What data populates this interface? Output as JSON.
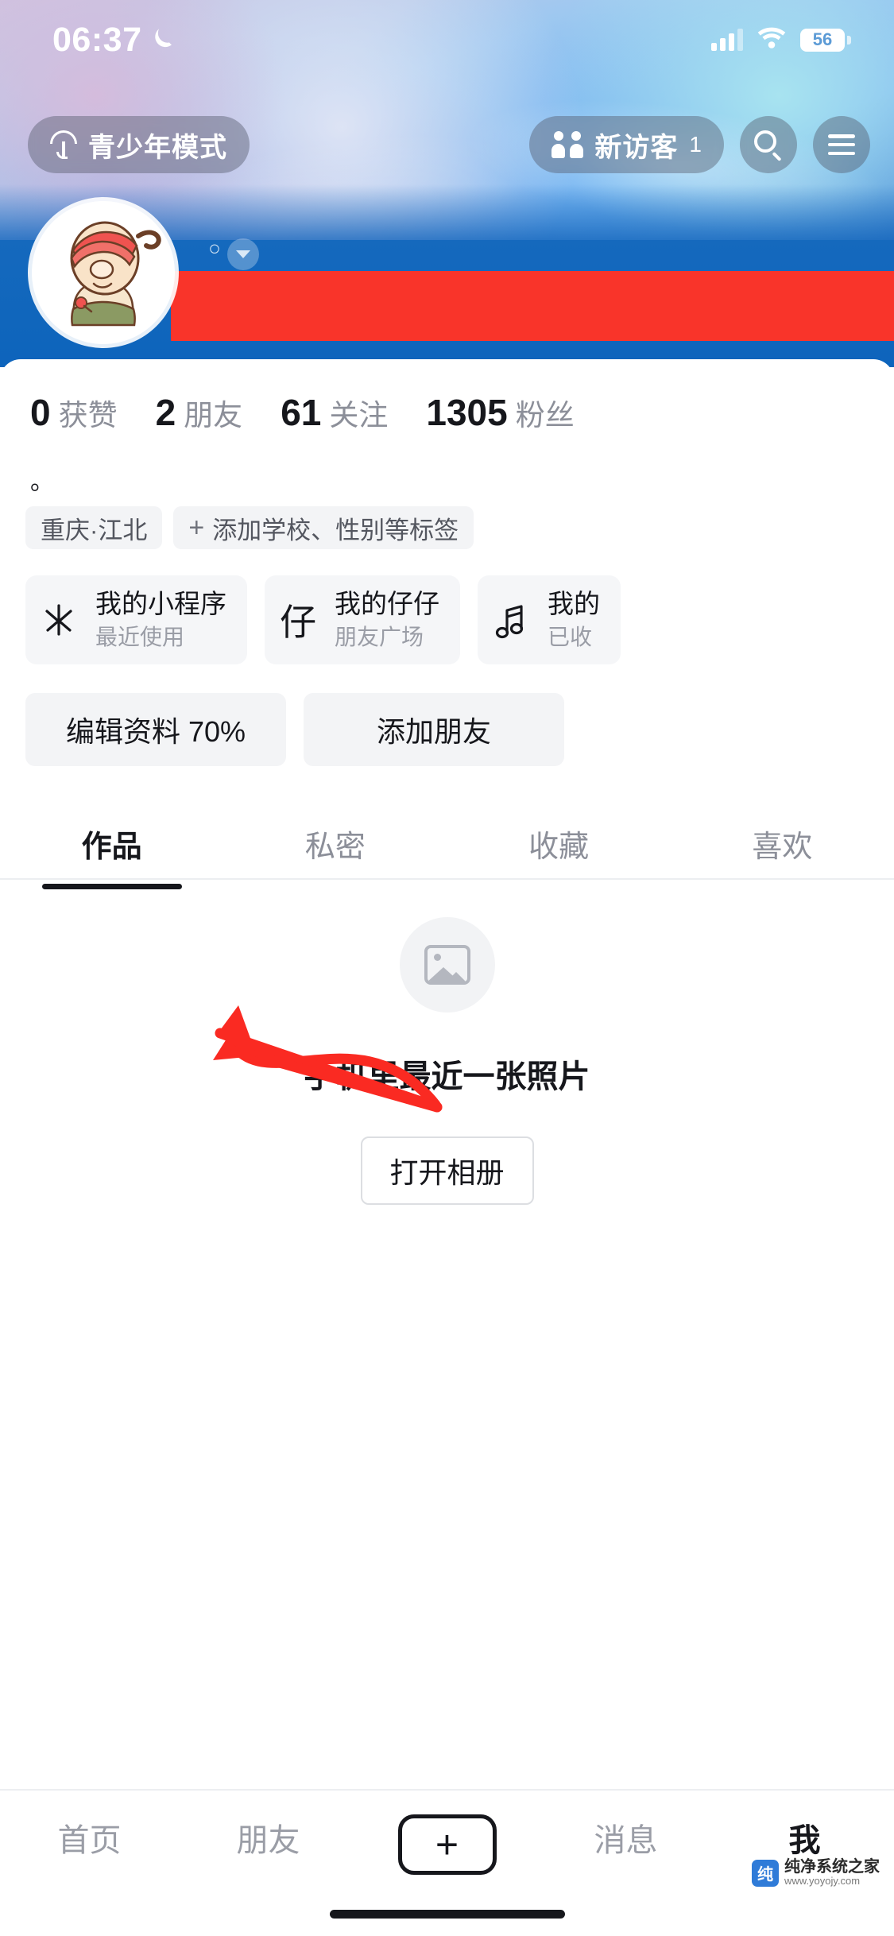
{
  "status_bar": {
    "time": "06:37",
    "moon_icon": "crescent-moon-icon",
    "signal_icon": "cellular-signal-icon",
    "wifi_icon": "wifi-icon",
    "battery_level": "56"
  },
  "top_bar": {
    "teen_mode_label": "青少年模式",
    "teen_mode_icon": "umbrella-icon",
    "visitor_label": "新访客",
    "visitor_count": "1",
    "visitor_icon": "people-icon",
    "search_icon": "search-icon",
    "menu_icon": "hamburger-menu-icon"
  },
  "profile": {
    "avatar_icon": "user-avatar",
    "gender_icon": "gender-dot",
    "expand_icon": "chevron-down-icon",
    "name_redacted": true,
    "bio": "。",
    "stats": [
      {
        "value": "0",
        "label": "获赞"
      },
      {
        "value": "2",
        "label": "朋友"
      },
      {
        "value": "61",
        "label": "关注"
      },
      {
        "value": "1305",
        "label": "粉丝"
      }
    ],
    "tags": [
      {
        "text": "重庆·江北",
        "has_plus": false
      },
      {
        "text": "添加学校、性别等标签",
        "has_plus": true
      }
    ]
  },
  "cards": [
    {
      "icon": "mini-program-icon",
      "glyph": "⽊",
      "title": "我的小程序",
      "subtitle": "最近使用"
    },
    {
      "icon": "zaizai-icon",
      "glyph": "仔",
      "title": "我的仔仔",
      "subtitle": "朋友广场"
    },
    {
      "icon": "music-icon",
      "glyph": "♬",
      "title": "我的",
      "subtitle": "已收"
    }
  ],
  "actions": [
    {
      "label": "编辑资料 70%"
    },
    {
      "label": "添加朋友"
    }
  ],
  "tabs": [
    {
      "label": "作品",
      "active": true
    },
    {
      "label": "私密",
      "active": false
    },
    {
      "label": "收藏",
      "active": false
    },
    {
      "label": "喜欢",
      "active": false
    }
  ],
  "empty_state": {
    "icon": "photo-placeholder-icon",
    "text": "手机里最近一张照片",
    "button_label": "打开相册"
  },
  "bottom_nav": [
    {
      "label": "首页",
      "active": false
    },
    {
      "label": "朋友",
      "active": false
    },
    {
      "label": "+",
      "active": false,
      "is_plus": true
    },
    {
      "label": "消息",
      "active": false
    },
    {
      "label": "我",
      "active": true
    }
  ],
  "watermark": {
    "title": "纯净系统之家",
    "subtitle": "www.yoyojy.com",
    "logo_text": "纯"
  },
  "colors": {
    "accent_blue": "#0d64bc",
    "redaction_red": "#f9342a",
    "arrow_red": "#fa2a22",
    "text_primary": "#16171c",
    "text_secondary": "#8c8f99",
    "chip_bg": "#f3f4f6"
  }
}
